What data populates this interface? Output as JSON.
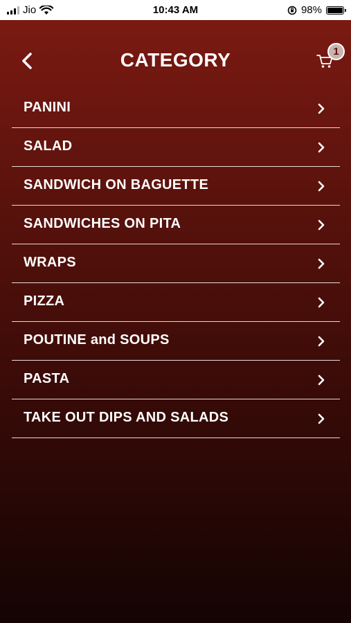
{
  "status_bar": {
    "carrier": "Jio",
    "time": "10:43 AM",
    "battery": "98%"
  },
  "header": {
    "title": "CATEGORY",
    "cart_count": "1"
  },
  "categories": [
    {
      "label": "PANINI"
    },
    {
      "label": "SALAD"
    },
    {
      "label": "SANDWICH ON BAGUETTE"
    },
    {
      "label": "SANDWICHES ON PITA"
    },
    {
      "label": "WRAPS"
    },
    {
      "label": "PIZZA"
    },
    {
      "label": "POUTINE and SOUPS"
    },
    {
      "label": "PASTA"
    },
    {
      "label": "TAKE OUT DIPS AND SALADS"
    }
  ],
  "colors": {
    "gradient_top": "#7a1a12",
    "gradient_bottom": "#140403",
    "text": "#ffffff",
    "divider": "#e8dcda"
  },
  "icons": {
    "back": "chevron-left-icon",
    "cart": "cart-icon",
    "row_arrow": "chevron-right-icon"
  }
}
